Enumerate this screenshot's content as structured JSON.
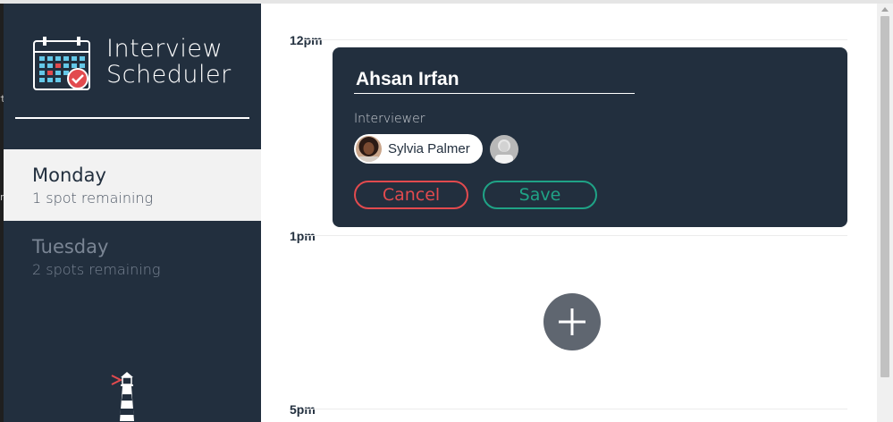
{
  "app": {
    "title_line1": "Interview",
    "title_line2": "Scheduler"
  },
  "days": [
    {
      "name": "Monday",
      "spots": "1 spot remaining",
      "selected": true
    },
    {
      "name": "Tuesday",
      "spots": "2 spots remaining",
      "selected": false
    }
  ],
  "schedule": {
    "slots": [
      "12pm",
      "1pm",
      "5pm"
    ]
  },
  "form": {
    "student_name": "Ahsan Irfan",
    "interviewer_label": "Interviewer",
    "selected_interviewer": "Sylvia Palmer",
    "cancel_label": "Cancel",
    "save_label": "Save"
  },
  "colors": {
    "sidebar_bg": "#222f3e",
    "card_bg": "#222f3e",
    "danger": "#e24a4e",
    "success": "#1fa386",
    "add_button": "#5f6670"
  },
  "icons": {
    "logo": "calendar-check-icon",
    "lighthouse": "lighthouse-icon",
    "add": "plus-icon"
  }
}
